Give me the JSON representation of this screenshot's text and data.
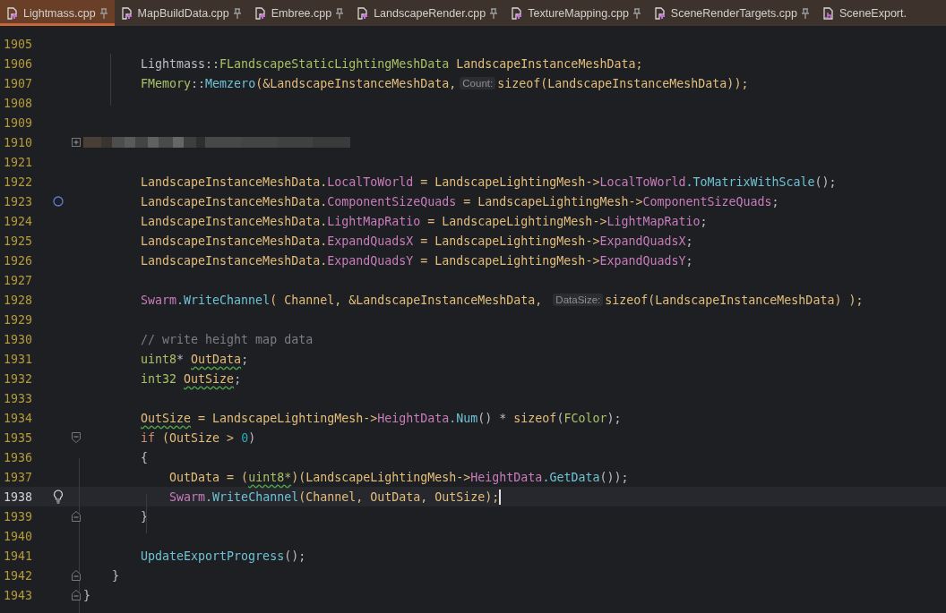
{
  "tabs": [
    {
      "label": "Lightmass.cpp",
      "kind": "cpp",
      "selected": true,
      "pinned": true
    },
    {
      "label": "MapBuildData.cpp",
      "kind": "cpp",
      "selected": false,
      "pinned": true
    },
    {
      "label": "Embree.cpp",
      "kind": "cpp",
      "selected": false,
      "pinned": true
    },
    {
      "label": "LandscapeRender.cpp",
      "kind": "cpp",
      "selected": false,
      "pinned": true
    },
    {
      "label": "TextureMapping.cpp",
      "kind": "cpp",
      "selected": false,
      "pinned": true
    },
    {
      "label": "SceneRenderTargets.cpp",
      "kind": "cpp",
      "selected": false,
      "pinned": true
    },
    {
      "label": "SceneExport.",
      "kind": "h",
      "selected": false,
      "pinned": false
    }
  ],
  "editor": {
    "lines": [
      {
        "number": "1905",
        "kind": "code",
        "current": false
      },
      {
        "number": "1906",
        "kind": "code",
        "current": false,
        "tokens": [
          {
            "text": "        Lightmass::",
            "kind": "plain"
          },
          {
            "text": "FLandscapeStaticLightingMeshData",
            "kind": "type"
          },
          {
            "text": " LandscapeInstanceMeshData;",
            "kind": "var"
          }
        ]
      },
      {
        "number": "1907",
        "kind": "code",
        "current": false,
        "tokens": [
          {
            "text": "        FMemory",
            "kind": "type"
          },
          {
            "text": "::",
            "kind": "plain"
          },
          {
            "text": "Memzero",
            "kind": "func"
          },
          {
            "text": "(&LandscapeInstanceMeshData,",
            "kind": "var"
          },
          {
            "text": "Count:",
            "kind": "hint"
          },
          {
            "text": "sizeof",
            "kind": "var"
          },
          {
            "text": "(LandscapeInstanceMeshData));",
            "kind": "var"
          }
        ]
      },
      {
        "number": "1908",
        "kind": "code",
        "current": false
      },
      {
        "number": "1909",
        "kind": "code",
        "current": false
      },
      {
        "number": "1910",
        "kind": "redacted",
        "current": false,
        "marker": {
          "kind": "fold-expand"
        }
      },
      {
        "number": "1921",
        "kind": "code",
        "current": false
      },
      {
        "number": "1922",
        "kind": "code",
        "current": false,
        "tokens": [
          {
            "text": "        LandscapeInstanceMeshData.",
            "kind": "var"
          },
          {
            "text": "LocalToWorld",
            "kind": "member"
          },
          {
            "text": " = LandscapeLightingMesh->",
            "kind": "var"
          },
          {
            "text": "LocalToWorld",
            "kind": "member"
          },
          {
            "text": ".ToMatrixWithScale",
            "kind": "func"
          },
          {
            "text": "();",
            "kind": "plain"
          }
        ]
      },
      {
        "number": "1923",
        "kind": "code",
        "current": false,
        "marker": {
          "kind": "circle"
        },
        "tokens": [
          {
            "text": "        LandscapeInstanceMeshData.",
            "kind": "var"
          },
          {
            "text": "ComponentSizeQuads",
            "kind": "member"
          },
          {
            "text": " = LandscapeLightingMesh->",
            "kind": "var"
          },
          {
            "text": "ComponentSizeQuads",
            "kind": "member"
          },
          {
            "text": ";",
            "kind": "plain"
          }
        ]
      },
      {
        "number": "1924",
        "kind": "code",
        "current": false,
        "tokens": [
          {
            "text": "        LandscapeInstanceMeshData.",
            "kind": "var"
          },
          {
            "text": "LightMapRatio",
            "kind": "member"
          },
          {
            "text": " = LandscapeLightingMesh->",
            "kind": "var"
          },
          {
            "text": "LightMapRatio",
            "kind": "member"
          },
          {
            "text": ";",
            "kind": "plain"
          }
        ]
      },
      {
        "number": "1925",
        "kind": "code",
        "current": false,
        "tokens": [
          {
            "text": "        LandscapeInstanceMeshData.",
            "kind": "var"
          },
          {
            "text": "ExpandQuadsX",
            "kind": "member"
          },
          {
            "text": " = LandscapeLightingMesh->",
            "kind": "var"
          },
          {
            "text": "ExpandQuadsX",
            "kind": "member"
          },
          {
            "text": ";",
            "kind": "plain"
          }
        ]
      },
      {
        "number": "1926",
        "kind": "code",
        "current": false,
        "tokens": [
          {
            "text": "        LandscapeInstanceMeshData.",
            "kind": "var"
          },
          {
            "text": "ExpandQuadsY",
            "kind": "member"
          },
          {
            "text": " = LandscapeLightingMesh->",
            "kind": "var"
          },
          {
            "text": "ExpandQuadsY",
            "kind": "member"
          },
          {
            "text": ";",
            "kind": "plain"
          }
        ]
      },
      {
        "number": "1927",
        "kind": "code",
        "current": false
      },
      {
        "number": "1928",
        "kind": "code",
        "current": false,
        "tokens": [
          {
            "text": "        Swarm",
            "kind": "member"
          },
          {
            "text": ".WriteChannel",
            "kind": "func"
          },
          {
            "text": "( Channel, &LandscapeInstanceMeshData, ",
            "kind": "var"
          },
          {
            "text": "DataSize:",
            "kind": "hint"
          },
          {
            "text": "sizeof(LandscapeInstanceMeshData) );",
            "kind": "var"
          }
        ]
      },
      {
        "number": "1929",
        "kind": "code",
        "current": false
      },
      {
        "number": "1930",
        "kind": "code",
        "current": false,
        "tokens": [
          {
            "text": "        // write height map data",
            "kind": "comment"
          }
        ]
      },
      {
        "number": "1931",
        "kind": "code",
        "current": false,
        "tokens": [
          {
            "text": "        uint8",
            "kind": "type"
          },
          {
            "text": "* ",
            "kind": "plain"
          },
          {
            "text": "OutData",
            "kind": "var_warn"
          },
          {
            "text": ";",
            "kind": "plain"
          }
        ]
      },
      {
        "number": "1932",
        "kind": "code",
        "current": false,
        "tokens": [
          {
            "text": "        int32 ",
            "kind": "type"
          },
          {
            "text": "OutSize",
            "kind": "var_warn"
          },
          {
            "text": ";",
            "kind": "plain"
          }
        ]
      },
      {
        "number": "1933",
        "kind": "code",
        "current": false
      },
      {
        "number": "1934",
        "kind": "code",
        "current": false,
        "tokens": [
          {
            "text": "        OutSize",
            "kind": "var_warn"
          },
          {
            "text": " = LandscapeLightingMesh->",
            "kind": "var"
          },
          {
            "text": "HeightData",
            "kind": "member"
          },
          {
            "text": ".Num",
            "kind": "func"
          },
          {
            "text": "() * ",
            "kind": "plain"
          },
          {
            "text": "sizeof",
            "kind": "var"
          },
          {
            "text": "(",
            "kind": "plain"
          },
          {
            "text": "FColor",
            "kind": "type"
          },
          {
            "text": ");",
            "kind": "plain"
          }
        ]
      },
      {
        "number": "1935",
        "kind": "code",
        "current": false,
        "marker": {
          "kind": "fold-start"
        },
        "tokens": [
          {
            "text": "        if",
            "kind": "keyword"
          },
          {
            "text": " (OutSize > ",
            "kind": "var"
          },
          {
            "text": "0",
            "kind": "number"
          },
          {
            "text": ")",
            "kind": "plain"
          }
        ]
      },
      {
        "number": "1936",
        "kind": "code",
        "current": false,
        "tokens": [
          {
            "text": "        {",
            "kind": "plain"
          }
        ]
      },
      {
        "number": "1937",
        "kind": "code",
        "current": false,
        "tokens": [
          {
            "text": "            OutData = (",
            "kind": "var"
          },
          {
            "text": "uint8*",
            "kind": "type_warn"
          },
          {
            "text": ")(LandscapeLightingMesh->",
            "kind": "var"
          },
          {
            "text": "HeightData",
            "kind": "member"
          },
          {
            "text": ".GetData",
            "kind": "func"
          },
          {
            "text": "());",
            "kind": "plain"
          }
        ]
      },
      {
        "number": "1938",
        "kind": "code",
        "current": true,
        "marker": {
          "kind": "bulb"
        },
        "tokens": [
          {
            "text": "            Swarm",
            "kind": "member"
          },
          {
            "text": ".WriteChannel",
            "kind": "func"
          },
          {
            "text": "(Channel, OutData, OutSize);",
            "kind": "var"
          }
        ]
      },
      {
        "number": "1939",
        "kind": "code",
        "current": false,
        "marker": {
          "kind": "fold-end"
        },
        "tokens": [
          {
            "text": "        }",
            "kind": "plain"
          }
        ]
      },
      {
        "number": "1940",
        "kind": "code",
        "current": false
      },
      {
        "number": "1941",
        "kind": "code",
        "current": false,
        "tokens": [
          {
            "text": "        UpdateExportProgress",
            "kind": "func"
          },
          {
            "text": "();",
            "kind": "plain"
          }
        ]
      },
      {
        "number": "1942",
        "kind": "code",
        "current": false,
        "marker": {
          "kind": "fold-end"
        },
        "tokens": [
          {
            "text": "    }",
            "kind": "plain"
          }
        ]
      },
      {
        "number": "1943",
        "kind": "code",
        "current": false,
        "marker": {
          "kind": "fold-end"
        },
        "tokens": [
          {
            "text": "}",
            "kind": "plain"
          }
        ]
      }
    ]
  }
}
